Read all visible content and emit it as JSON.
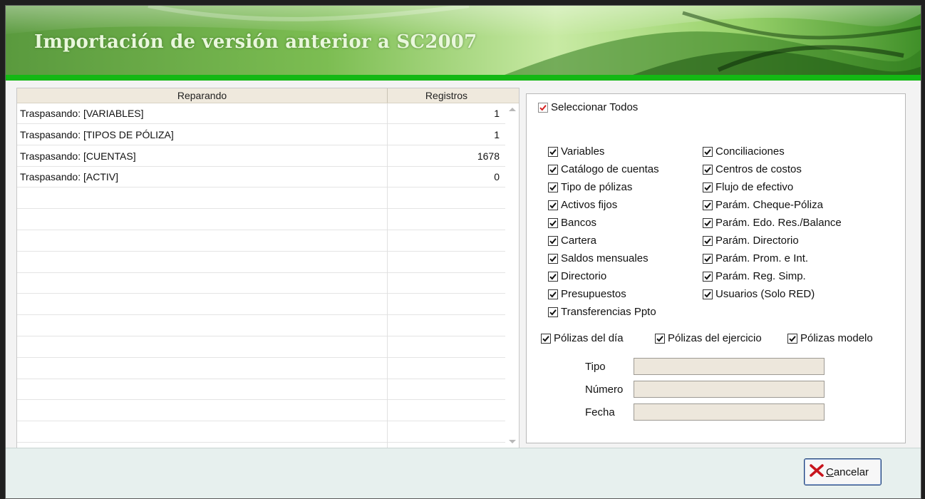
{
  "window": {
    "title": "Importación de versión anterior a SC2007"
  },
  "grid": {
    "columns": {
      "reparando": "Reparando",
      "registros": "Registros"
    },
    "rows": [
      {
        "reparando": "Traspasando: [VARIABLES]",
        "registros": "1"
      },
      {
        "reparando": "Traspasando: [TIPOS DE PÓLIZA]",
        "registros": "1"
      },
      {
        "reparando": "Traspasando: [CUENTAS]",
        "registros": "1678"
      },
      {
        "reparando": "Traspasando: [ACTIV]",
        "registros": "0"
      }
    ]
  },
  "options": {
    "select_all": {
      "label": "Seleccionar Todos",
      "checked": true
    },
    "left_column": [
      {
        "label": "Variables",
        "checked": true
      },
      {
        "label": "Catálogo de cuentas",
        "checked": true
      },
      {
        "label": "Tipo de pólizas",
        "checked": true
      },
      {
        "label": "Activos fijos",
        "checked": true
      },
      {
        "label": "Bancos",
        "checked": true
      },
      {
        "label": "Cartera",
        "checked": true
      },
      {
        "label": "Saldos mensuales",
        "checked": true
      },
      {
        "label": "Directorio",
        "checked": true
      },
      {
        "label": "Presupuestos",
        "checked": true
      },
      {
        "label": "Transferencias Ppto",
        "checked": true
      }
    ],
    "right_column": [
      {
        "label": "Conciliaciones",
        "checked": true
      },
      {
        "label": "Centros de costos",
        "checked": true
      },
      {
        "label": "Flujo de efectivo",
        "checked": true
      },
      {
        "label": "Parám. Cheque-Póliza",
        "checked": true
      },
      {
        "label": "Parám. Edo. Res./Balance",
        "checked": true
      },
      {
        "label": "Parám. Directorio",
        "checked": true
      },
      {
        "label": "Parám. Prom. e Int.",
        "checked": true
      },
      {
        "label": "Parám. Reg. Simp.",
        "checked": true
      },
      {
        "label": "Usuarios (Solo RED)",
        "checked": true
      }
    ],
    "polizas": [
      {
        "label": "Pólizas del día",
        "checked": true
      },
      {
        "label": "Pólizas del ejercicio",
        "checked": true
      },
      {
        "label": "Pólizas modelo",
        "checked": true
      }
    ],
    "fields": {
      "tipo": {
        "label": "Tipo",
        "value": ""
      },
      "numero": {
        "label": "Número",
        "value": ""
      },
      "fecha": {
        "label": "Fecha",
        "value": ""
      }
    }
  },
  "buttons": {
    "cancel": {
      "label_hotkey": "C",
      "label_rest": "ancelar"
    }
  },
  "colors": {
    "accent_green": "#14b814",
    "check_red": "#d42020",
    "button_border": "#1e3f78"
  }
}
